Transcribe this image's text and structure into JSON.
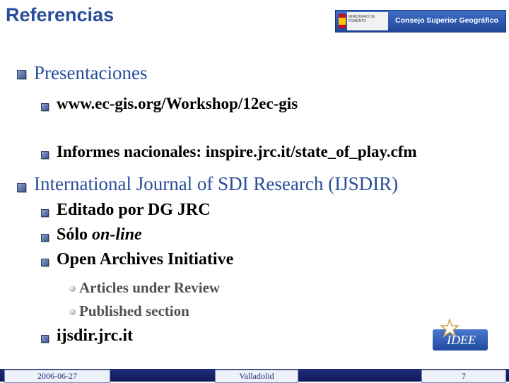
{
  "header": {
    "title": "Referencias",
    "banner_text": "Consejo Superior Geográfico",
    "ministry_text": "MINISTERIO DE FOMENTO"
  },
  "items": {
    "presentaciones": "Presentaciones",
    "url_workshop": "www.ec-gis.org/Workshop/12ec-gis",
    "informes": "Informes nacionales: inspire.jrc.it/state_of_play.cfm",
    "ijsdir": "International Journal of SDI Research (IJSDIR)",
    "editado": "Editado por DG JRC",
    "solo_prefix": "Sólo ",
    "solo_online": "on-line",
    "open_archives": "Open Archives Initiative",
    "articles": "Articles under Review",
    "published": "Published section",
    "ijsdir_url": "ijsdir.jrc.it"
  },
  "logo": {
    "text": "IDEE"
  },
  "footer": {
    "date": "2006-06-27",
    "place": "Valladolid",
    "page": "7"
  },
  "colors": {
    "title": "#2a4d9b",
    "footer": "#1e2c78"
  }
}
